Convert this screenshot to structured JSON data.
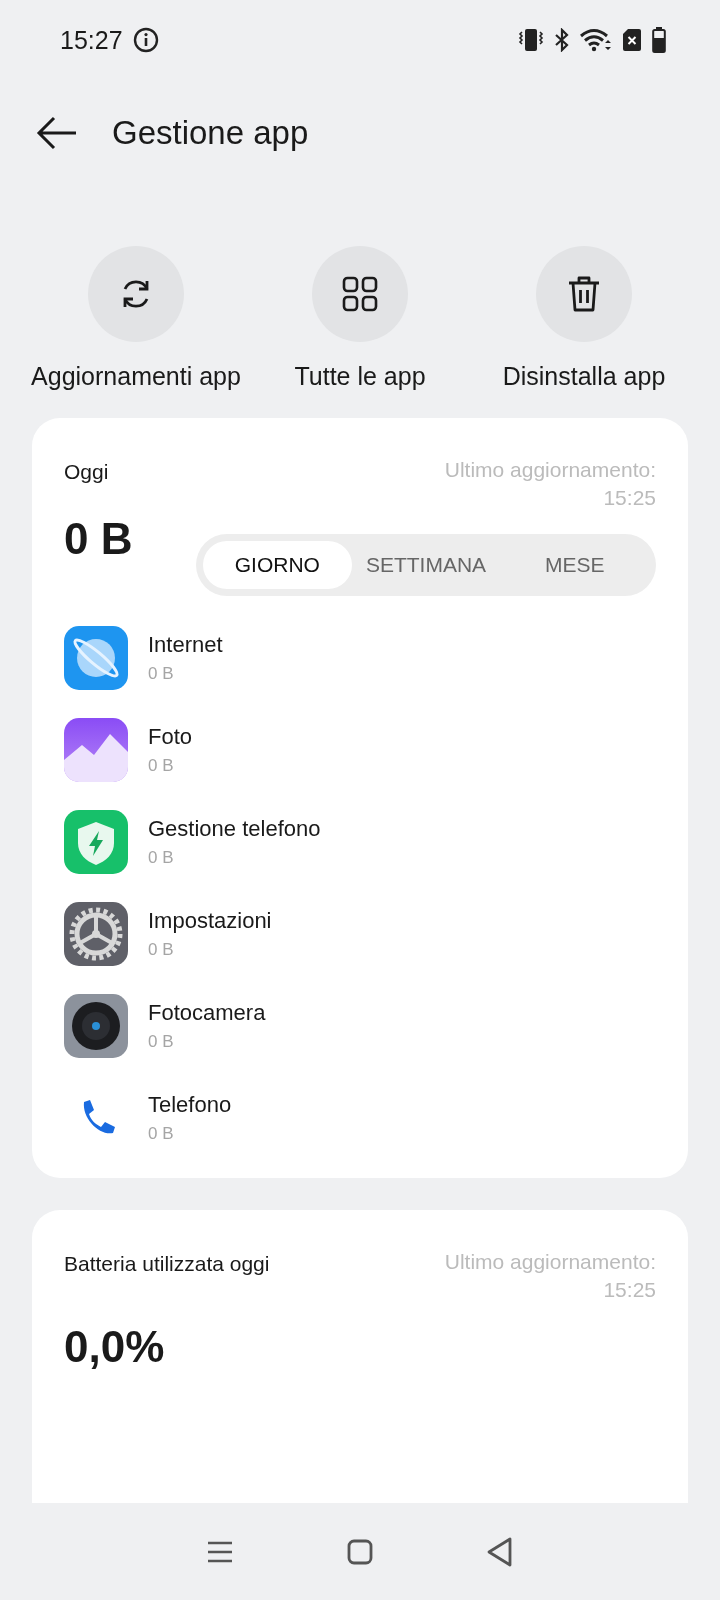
{
  "status_bar": {
    "time": "15:27"
  },
  "header": {
    "title": "Gestione app"
  },
  "actions": [
    {
      "label": "Aggiornamenti app",
      "kind": "refresh"
    },
    {
      "label": "Tutte le app",
      "kind": "grid"
    },
    {
      "label": "Disinstalla app",
      "kind": "trash"
    }
  ],
  "data_card": {
    "title": "Oggi",
    "updated": "Ultimo aggiornamento: 15:25",
    "total": "0 B",
    "tabs": [
      {
        "label": "GIORNO",
        "selected": true
      },
      {
        "label": "SETTIMANA",
        "selected": false
      },
      {
        "label": "MESE",
        "selected": false
      }
    ],
    "apps": [
      {
        "name": "Internet",
        "usage": "0 B",
        "kind": "browser"
      },
      {
        "name": "Foto",
        "usage": "0 B",
        "kind": "gallery"
      },
      {
        "name": "Gestione telefono",
        "usage": "0 B",
        "kind": "security"
      },
      {
        "name": "Impostazioni",
        "usage": "0 B",
        "kind": "settings"
      },
      {
        "name": "Fotocamera",
        "usage": "0 B",
        "kind": "camera"
      },
      {
        "name": "Telefono",
        "usage": "0 B",
        "kind": "phone"
      }
    ]
  },
  "battery_card": {
    "title": "Batteria utilizzata oggi",
    "updated": "Ultimo aggiornamento: 15:25",
    "total": "0,0%"
  }
}
